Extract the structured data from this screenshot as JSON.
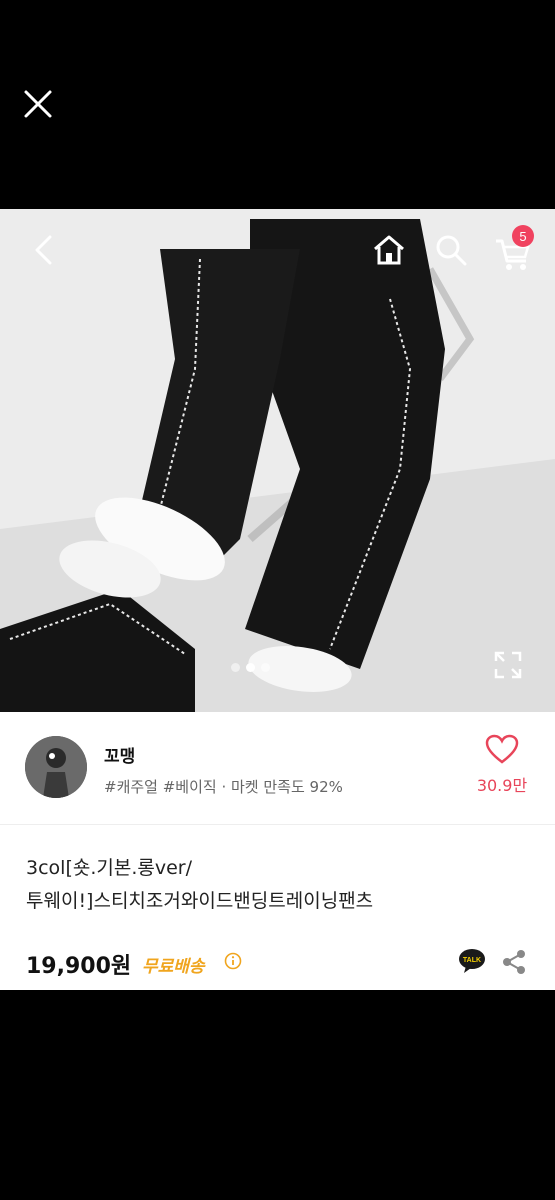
{
  "nav": {
    "close_icon": "close-icon"
  },
  "gallery": {
    "cart_count": "5",
    "slides": 3,
    "active_slide": 2,
    "icons": [
      "back-arrow-icon",
      "home-icon",
      "search-icon",
      "cart-icon",
      "expand-icon"
    ]
  },
  "seller": {
    "name": "꼬맹",
    "tags": "#캐주얼 #베이직 · 마켓 만족도 92%",
    "likes": "30.9만"
  },
  "product": {
    "title_line1": "3col[숏.기본.롱ver/",
    "title_line2": "투웨이!]스티치조거와이드밴딩트레이닝팬츠",
    "price": "19,900원",
    "shipping": "무료배송"
  },
  "colors": {
    "accent": "#e8455a",
    "shipping": "#f0a51e",
    "badge": "#f0425f"
  }
}
